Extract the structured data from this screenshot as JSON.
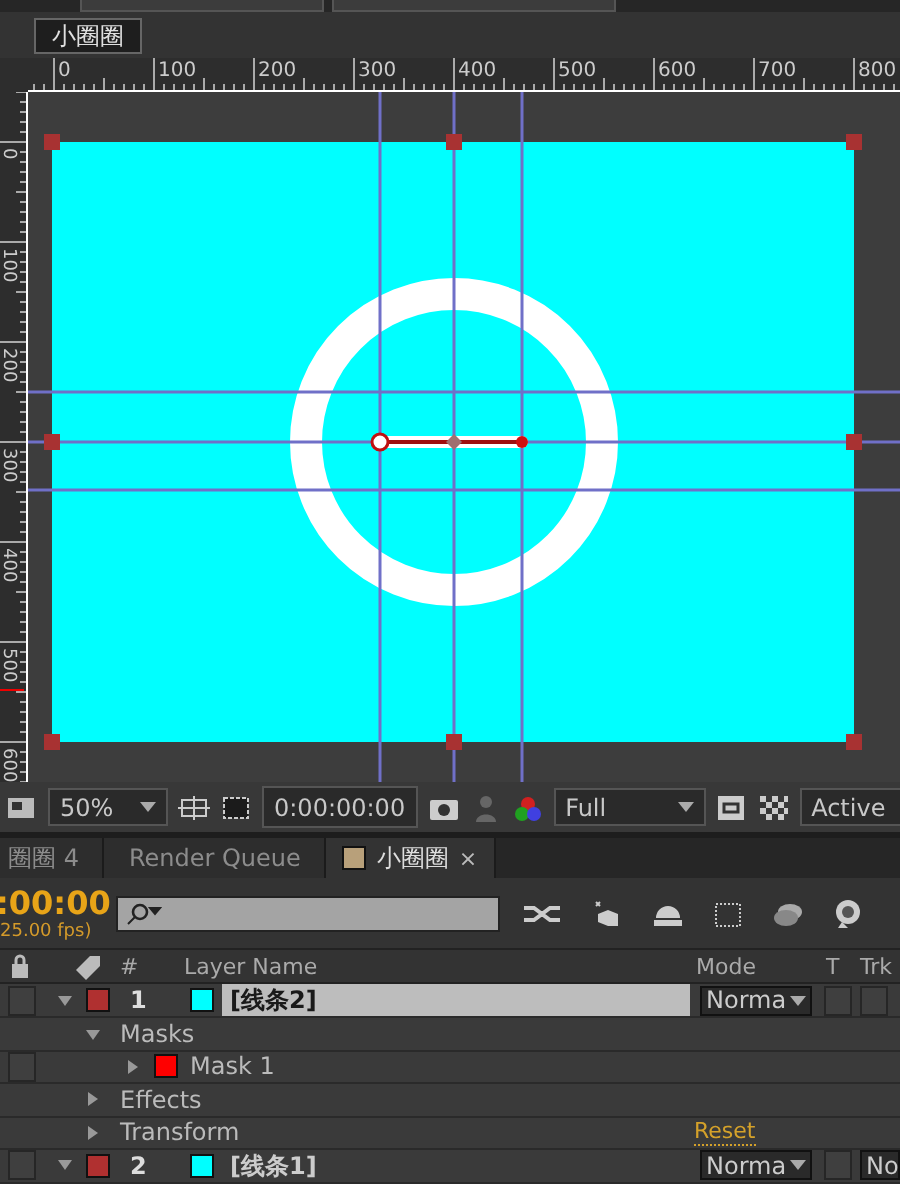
{
  "viewer_tab": {
    "label": "小圈圈"
  },
  "ruler_h": [
    "0",
    "100",
    "200",
    "300",
    "400",
    "500",
    "600",
    "700",
    "800"
  ],
  "ruler_v": [
    "0",
    "100",
    "200",
    "300",
    "400",
    "500",
    "600"
  ],
  "viewer_toolbar": {
    "zoom": "50%",
    "timecode": "0:00:00:00",
    "resolution": "Full",
    "view": "Active"
  },
  "panel_tabs": [
    {
      "label": "圈圈 4",
      "selected": false
    },
    {
      "label": "Render Queue",
      "selected": false
    },
    {
      "label": "小圈圈",
      "selected": true,
      "close": "×"
    }
  ],
  "timeline": {
    "time": ":00:00",
    "fps": "25.00 fps)"
  },
  "columns": [
    "#",
    "Layer Name",
    "Mode",
    "T",
    "Trk"
  ],
  "layers": [
    {
      "kind": "layer",
      "number": "1",
      "name": "[线条2]",
      "color": "#00ffff",
      "selected": true,
      "expanded": true,
      "mode": "Norma",
      "preserve_transparency": false,
      "children": [
        {
          "kind": "group",
          "name": "Masks",
          "expanded": true,
          "children": [
            {
              "kind": "mask",
              "name": "Mask 1",
              "color": "#ff0000",
              "expanded": false
            }
          ]
        },
        {
          "kind": "group",
          "name": "Effects",
          "expanded": false
        },
        {
          "kind": "group",
          "name": "Transform",
          "expanded": false,
          "action": "Reset"
        }
      ]
    },
    {
      "kind": "layer",
      "number": "2",
      "name": "[线条1]",
      "color": "#00ffff",
      "selected": false,
      "expanded": true,
      "mode": "Norma",
      "preserve_transparency": false,
      "trkmat": "No"
    }
  ]
}
